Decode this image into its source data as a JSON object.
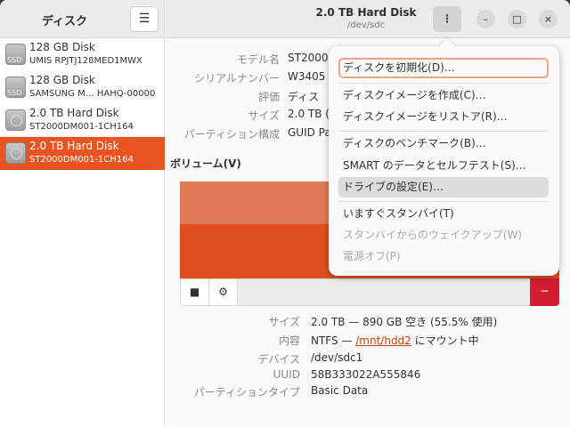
{
  "sidebar": {
    "title": "ディスク",
    "menu_icon": "hamburger-icon",
    "items": [
      {
        "name": "128 GB Disk",
        "model": "UMIS RPJTJ128MED1MWX",
        "icon": "ssd-icon",
        "badge": "SSD"
      },
      {
        "name": "128 GB Disk",
        "model": "SAMSUNG M… HAHQ-00000",
        "icon": "ssd-icon",
        "badge": "SSD"
      },
      {
        "name": "2.0 TB Hard Disk",
        "model": "ST2000DM001-1CH164",
        "icon": "hdd-icon"
      },
      {
        "name": "2.0 TB Hard Disk",
        "model": "ST2000DM001-1CH164",
        "icon": "hdd-icon",
        "selected": true
      }
    ]
  },
  "header": {
    "title": "2.0 TB Hard Disk",
    "subtitle": "/dev/sdc",
    "menu": "⋮",
    "minimize": "–",
    "maximize": "□",
    "close": "×"
  },
  "disk_info": [
    {
      "label": "モデル名",
      "value": "ST2000"
    },
    {
      "label": "シリアルナンバー",
      "value": "W3405"
    },
    {
      "label": "評価",
      "value": "ディス"
    },
    {
      "label": "サイズ",
      "value": "2.0 TB ("
    },
    {
      "label": "パーティション構成",
      "value": "GUID Pa"
    }
  ],
  "volumes": {
    "heading": "ボリューム(V)",
    "used_percent": 55.5,
    "stop": "■",
    "settings": "⚙",
    "delete": "−"
  },
  "partition_info": {
    "size_label": "サイズ",
    "size_value": "2.0 TB — 890 GB 空き (55.5% 使用)",
    "content_label": "内容",
    "content_prefix": "NTFS — ",
    "content_link": "/mnt/hdd2",
    "content_suffix": " にマウント中",
    "device_label": "デバイス",
    "device_value": "/dev/sdc1",
    "uuid_label": "UUID",
    "uuid_value": "58B333022A555846",
    "type_label": "パーティションタイプ",
    "type_value": "Basic Data"
  },
  "menu": {
    "items": [
      "ディスクを初期化(D)…",
      "ディスクイメージを作成(C)…",
      "ディスクイメージをリストア(R)…",
      "ディスクのベンチマーク(B)…",
      "SMART のデータとセルフテスト(S)…",
      "ドライブの設定(E)…",
      "いますぐスタンバイ(T)",
      "スタンバイからのウェイクアップ(W)",
      "電源オフ(P)"
    ]
  },
  "colors": {
    "accent": "#e95420",
    "delete": "#d41c33"
  }
}
